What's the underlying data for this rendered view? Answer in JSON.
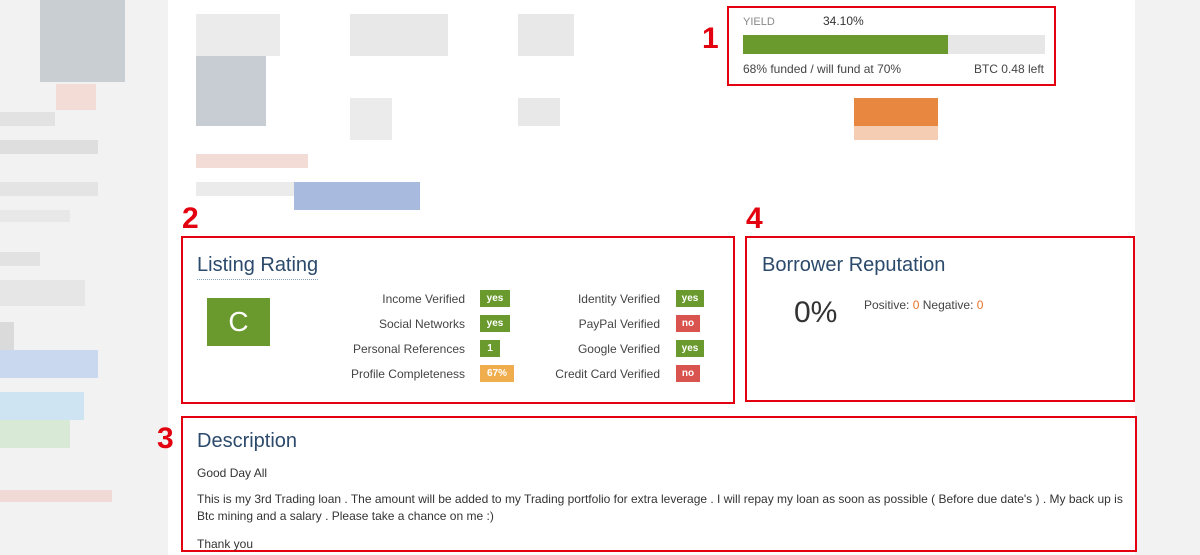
{
  "yield": {
    "label": "YIELD",
    "value": "34.10%",
    "funded_fraction": 0.68,
    "funded_text": "68% funded / will fund at 70%",
    "left_text": "BTC 0.48 left"
  },
  "markers": [
    "1",
    "2",
    "3",
    "4"
  ],
  "listing_rating": {
    "title": "Listing Rating",
    "grade": "C",
    "rows_left": [
      {
        "label": "Income Verified",
        "badge": "yes",
        "color": "green"
      },
      {
        "label": "Social Networks",
        "badge": "yes",
        "color": "green"
      },
      {
        "label": "Personal References",
        "badge": "1",
        "color": "green"
      },
      {
        "label": "Profile Completeness",
        "badge": "67%",
        "color": "orange"
      }
    ],
    "rows_right": [
      {
        "label": "Identity Verified",
        "badge": "yes",
        "color": "green"
      },
      {
        "label": "PayPal Verified",
        "badge": "no",
        "color": "red"
      },
      {
        "label": "Google Verified",
        "badge": "yes",
        "color": "green"
      },
      {
        "label": "Credit Card Verified",
        "badge": "no",
        "color": "red"
      }
    ]
  },
  "borrower_reputation": {
    "title": "Borrower Reputation",
    "percent": "0%",
    "positive_label": "Positive:",
    "positive_value": "0",
    "negative_label": "Negative:",
    "negative_value": "0"
  },
  "description": {
    "title": "Description",
    "greeting": "Good Day All",
    "body": "This is my 3rd Trading loan . The amount will be added to my Trading portfolio for extra leverage . I will repay my loan as soon as possible ( Before due date's ) . My back up is Btc mining and a salary . Please take a chance on me :)",
    "closing": "Thank you"
  },
  "colors": {
    "accent_red": "#e3000f",
    "success_green": "#6a9a2e",
    "danger_red": "#d9534f",
    "warning_orange": "#f0ad4e",
    "title_blue": "#2c4a6b"
  }
}
